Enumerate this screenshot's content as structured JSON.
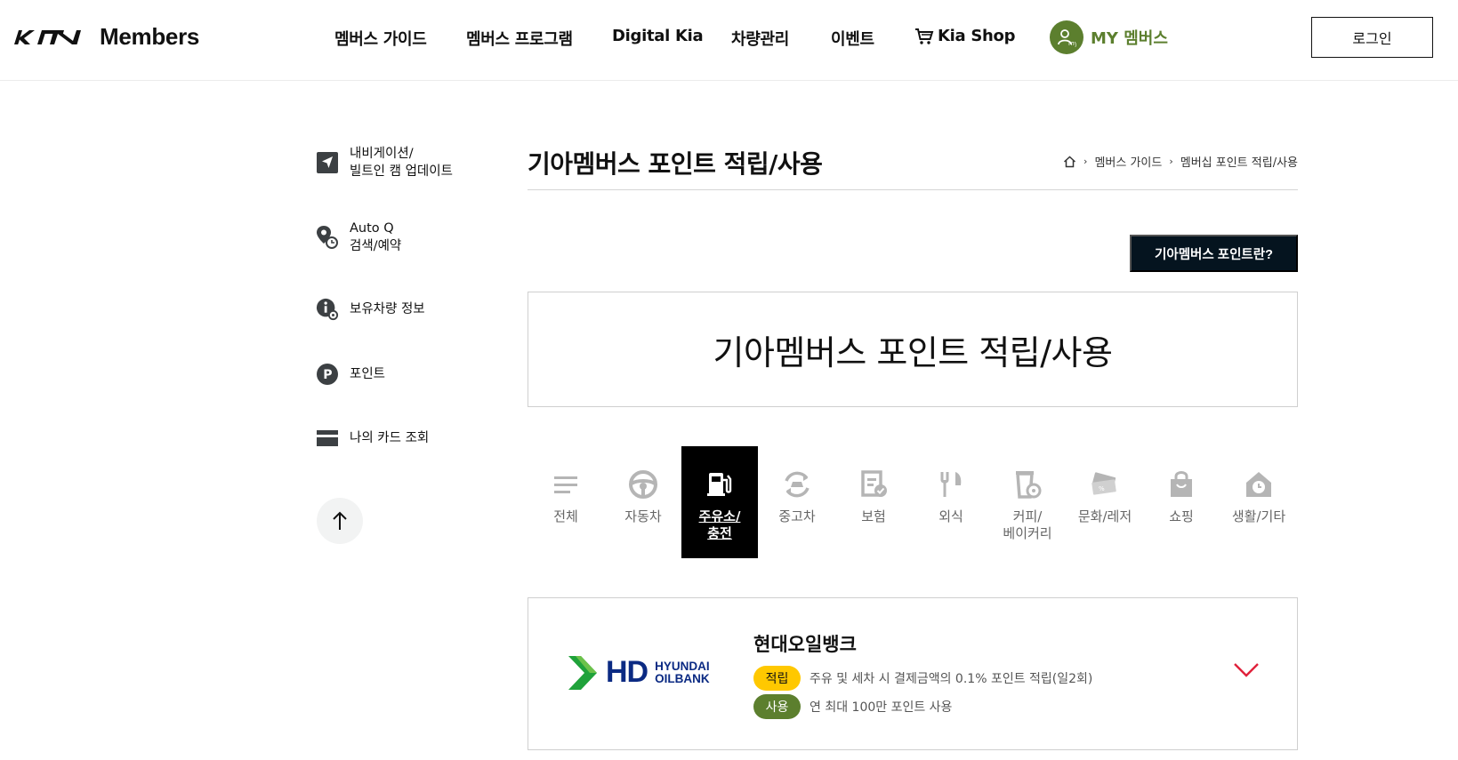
{
  "header": {
    "logo_text": "Members",
    "nav": [
      {
        "label": "멤버스 가이드"
      },
      {
        "label": "멤버스 프로그램"
      },
      {
        "label": "Digital Kia"
      },
      {
        "label": "차량관리"
      },
      {
        "label": "이벤트"
      },
      {
        "label": "Kia Shop",
        "icon": "cart-icon"
      }
    ],
    "my_label": "MY 멤버스",
    "login_label": "로그인"
  },
  "sidebar": {
    "items": [
      {
        "label_lines": [
          "내비게이션/",
          "빌트인 캠 업데이트"
        ],
        "icon": "navigation-icon"
      },
      {
        "label_lines": [
          "Auto Q",
          "검색/예약"
        ],
        "icon": "location-pin-icon"
      },
      {
        "label_lines": [
          "보유차량 정보"
        ],
        "icon": "info-icon"
      },
      {
        "label_lines": [
          "포인트"
        ],
        "icon": "point-icon"
      },
      {
        "label_lines": [
          "나의 카드 조회"
        ],
        "icon": "card-icon"
      }
    ],
    "top_button_icon": "arrow-up-icon"
  },
  "main": {
    "title": "기아멤버스 포인트 적립/사용",
    "breadcrumb": [
      "멤버스 가이드",
      "멤버십 포인트 적립/사용"
    ],
    "info_button_label": "기아멤버스 포인트란?",
    "hero_title": "기아멤버스 포인트 적립/사용",
    "categories": [
      {
        "label": "전체",
        "icon": "list-icon",
        "active": false
      },
      {
        "label": "자동차",
        "icon": "steering-wheel-icon",
        "active": false
      },
      {
        "label": "주유소/\n충전",
        "icon": "fuel-pump-icon",
        "active": true
      },
      {
        "label": "중고차",
        "icon": "used-car-icon",
        "active": false
      },
      {
        "label": "보험",
        "icon": "insurance-icon",
        "active": false
      },
      {
        "label": "외식",
        "icon": "fork-knife-icon",
        "active": false
      },
      {
        "label": "커피/\n베이커리",
        "icon": "coffee-icon",
        "active": false
      },
      {
        "label": "문화/레저",
        "icon": "ticket-icon",
        "active": false
      },
      {
        "label": "쇼핑",
        "icon": "shopping-bag-icon",
        "active": false
      },
      {
        "label": "생활/기타",
        "icon": "home-clock-icon",
        "active": false
      }
    ],
    "partner": {
      "logo_text": "HD",
      "logo_sub_lines": [
        "HYUNDAI",
        "OILBANK"
      ],
      "name": "현대오일뱅크",
      "earn_badge": "적립",
      "earn_text": "주유 및 세차 시 결제금액의 0.1% 포인트 적립(일2회)",
      "use_badge": "사용",
      "use_text": "연 최대 100만 포인트 사용"
    }
  },
  "colors": {
    "brand_dark": "#05141f",
    "accent_green": "#5c7f2e",
    "earn_yellow": "#ffc800",
    "chevron_red": "#e0213b"
  }
}
